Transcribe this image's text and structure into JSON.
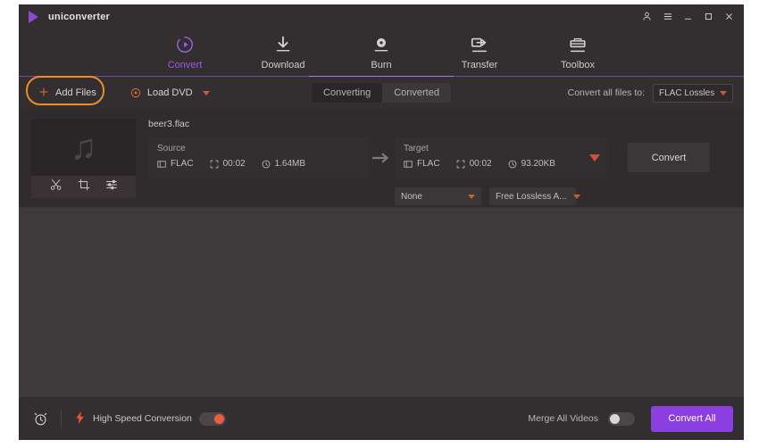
{
  "window": {
    "title": "uniconverter",
    "controls": [
      {
        "name": "account-icon",
        "glyph": "&#128100;"
      },
      {
        "name": "menu-icon",
        "glyph": "☰"
      },
      {
        "name": "minimize-icon",
        "glyph": "–"
      },
      {
        "name": "maximize-icon",
        "glyph": "☐"
      },
      {
        "name": "close-icon",
        "glyph": "✕"
      }
    ]
  },
  "nav": {
    "items": [
      {
        "label": "Convert",
        "icon": "convert-icon",
        "active": true
      },
      {
        "label": "Download",
        "icon": "download-icon",
        "active": false
      },
      {
        "label": "Burn",
        "icon": "burn-icon",
        "active": false
      },
      {
        "label": "Transfer",
        "icon": "transfer-icon",
        "active": false
      },
      {
        "label": "Toolbox",
        "icon": "toolbox-icon",
        "active": false
      }
    ],
    "accent_color": "#9a5ce0"
  },
  "toolbar": {
    "add_files_label": "Add Files",
    "load_dvd_label": "Load DVD",
    "tabs": [
      {
        "label": "Converting",
        "active": true
      },
      {
        "label": "Converted",
        "active": false
      }
    ],
    "convert_all_to_label": "Convert all files to:",
    "format_value": "FLAC Lossless ...",
    "highlight_color": "#f08b2c",
    "accent_color": "#e06a3a"
  },
  "file": {
    "name": "beer3.flac",
    "thumb_icon": "music-note-icon",
    "tools": [
      {
        "name": "trim-icon"
      },
      {
        "name": "crop-icon"
      },
      {
        "name": "effects-icon"
      }
    ],
    "source": {
      "title": "Source",
      "format": "FLAC",
      "duration": "00:02",
      "size": "1.64MB"
    },
    "target": {
      "title": "Target",
      "format": "FLAC",
      "duration": "00:02",
      "size": "93.20KB"
    },
    "convert_label": "Convert",
    "sub_selects": [
      {
        "value": "None"
      },
      {
        "value": "Free Lossless A..."
      }
    ]
  },
  "footer": {
    "timer_icon": "alarm-clock-icon",
    "high_speed_label": "High Speed Conversion",
    "high_speed_on": true,
    "merge_label": "Merge All Videos",
    "merge_on": false,
    "convert_all_label": "Convert All",
    "convert_all_color": "#8b3fe0",
    "toggle_on_color": "#ec5e3c"
  }
}
